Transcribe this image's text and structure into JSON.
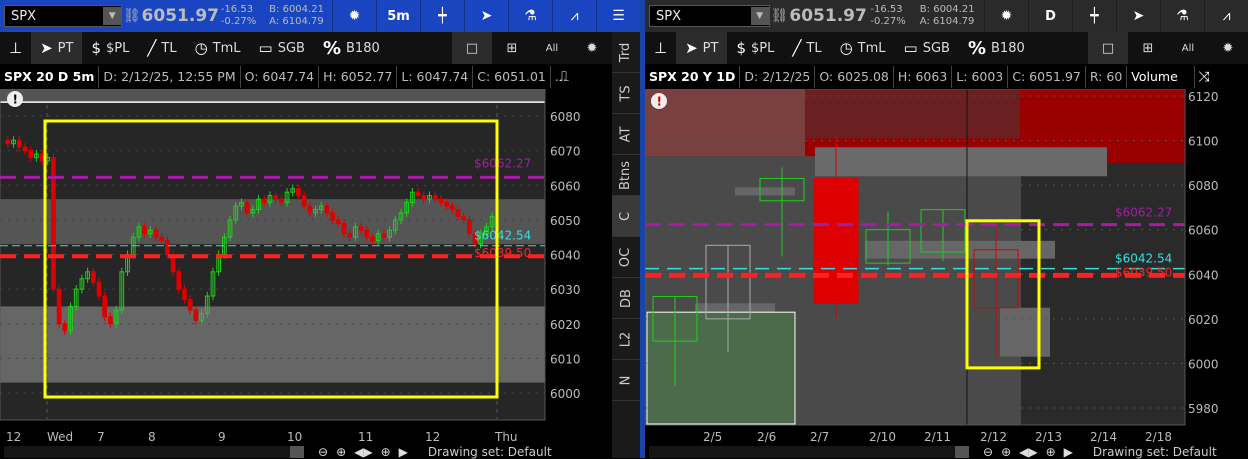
{
  "left": {
    "symbol": "SPX",
    "last": "6051.97",
    "change": "-16.53",
    "change_pct": "-0.27%",
    "bid": "B: 6004.21",
    "ask": "A: 6104.79",
    "timeframe": "5m",
    "tools": [
      {
        "icon": "pin",
        "label": ""
      },
      {
        "icon": "cursor",
        "label": "PT"
      },
      {
        "icon": "$",
        "label": "$PL"
      },
      {
        "icon": "/",
        "label": "TL"
      },
      {
        "icon": "clock",
        "label": "TmL"
      },
      {
        "icon": "□",
        "label": "SGB"
      },
      {
        "icon": "%",
        "label": "B180"
      }
    ],
    "all_label": "All",
    "info": {
      "title": "SPX 20 D 5m",
      "date": "D: 2/12/25, 12:55 PM",
      "open": "O: 6047.74",
      "high": "H: 6052.77",
      "low": "L: 6047.74",
      "close": "C: 6051.01",
      "more": "..."
    },
    "side_tabs": [
      "Trd",
      "TS",
      "AT",
      "Btns",
      "C",
      "OC",
      "DB",
      "L2",
      "N"
    ],
    "active_side_tab": "C",
    "xlabels": [
      "12",
      "Wed",
      "7",
      "8",
      "9",
      "10",
      "11",
      "12",
      "Thu"
    ],
    "drawing_set": "Drawing set: Default"
  },
  "right": {
    "symbol": "SPX",
    "last": "6051.97",
    "change": "-16.53",
    "change_pct": "-0.27%",
    "bid": "B: 6004.21",
    "ask": "A: 6104.79",
    "timeframe": "D",
    "all_label": "All",
    "info": {
      "title": "SPX 20 Y 1D",
      "date": "D: 2/12/25",
      "open": "O: 6025.08",
      "high": "H: 6063",
      "low": "L: 6003",
      "close": "C: 6051.97",
      "range": "R: 60",
      "study": "Volume"
    },
    "xlabels": [
      "2/5",
      "2/6",
      "2/7",
      "2/10",
      "2/11",
      "2/12",
      "2/13",
      "2/14",
      "2/18"
    ],
    "drawing_set": "Drawing set: Default"
  },
  "colors": {
    "accent": "#1946c0",
    "up": "#22cc22",
    "down": "#dd0000",
    "purple": "#a020a0",
    "cyan": "#30e0e0",
    "yellow": "#ffff00"
  },
  "chart_data": [
    {
      "type": "candlestick",
      "title": "SPX 20 D 5m",
      "ylim": [
        5995,
        6085
      ],
      "yticks": [
        6000,
        6010,
        6020,
        6030,
        6040,
        6050,
        6060,
        6070,
        6080
      ],
      "levels": [
        {
          "label": "$6062.27",
          "value": 6062.27,
          "color": "#a020a0"
        },
        {
          "label": "$6042.54",
          "value": 6042.54,
          "color": "#30e0e0"
        },
        {
          "label": "$6039.50",
          "value": 6039.5,
          "color": "#ff2020"
        }
      ],
      "closes": [
        6072,
        6073,
        6071,
        6070,
        6068,
        6069,
        6067,
        6068,
        6030,
        6020,
        6018,
        6025,
        6030,
        6033,
        6035,
        6032,
        6028,
        6022,
        6020,
        6024,
        6035,
        6040,
        6045,
        6048,
        6046,
        6047,
        6045,
        6044,
        6040,
        6035,
        6030,
        6027,
        6024,
        6021,
        6023,
        6028,
        6035,
        6040,
        6045,
        6050,
        6054,
        6055,
        6052,
        6053,
        6056,
        6055,
        6057,
        6056,
        6055,
        6058,
        6059,
        6057,
        6054,
        6052,
        6053,
        6054,
        6052,
        6050,
        6049,
        6046,
        6045,
        6048,
        6047,
        6045,
        6044,
        6046,
        6045,
        6047,
        6050,
        6052,
        6055,
        6058,
        6057,
        6056,
        6057,
        6056,
        6055,
        6054,
        6053,
        6051,
        6050,
        6046,
        6043,
        6046,
        6048,
        6051
      ]
    },
    {
      "type": "candlestick",
      "title": "SPX 20 Y 1D",
      "ylim": [
        5972,
        6122
      ],
      "yticks": [
        5980,
        6000,
        6020,
        6040,
        6060,
        6080,
        6100,
        6120
      ],
      "levels": [
        {
          "label": "$6062.27",
          "value": 6062.27,
          "color": "#a020a0"
        },
        {
          "label": "$6042.54",
          "value": 6042.54,
          "color": "#30e0e0"
        },
        {
          "label": "$6039.50",
          "value": 6039.5,
          "color": "#ff2020"
        }
      ],
      "candles": [
        {
          "date": "2/4",
          "o": 6010,
          "h": 6030,
          "l": 5990,
          "c": 6030,
          "style": "up"
        },
        {
          "date": "2/5",
          "o": 6020,
          "h": 6053,
          "l": 6005,
          "c": 6053,
          "style": "neutral"
        },
        {
          "date": "2/6",
          "o": 6073,
          "h": 6088,
          "l": 6048,
          "c": 6083,
          "style": "up"
        },
        {
          "date": "2/7",
          "o": 6083,
          "h": 6102,
          "l": 6020,
          "c": 6027,
          "style": "downfill"
        },
        {
          "date": "2/10",
          "o": 6045,
          "h": 6068,
          "l": 6044,
          "c": 6060,
          "style": "up"
        },
        {
          "date": "2/11",
          "o": 6050,
          "h": 6069,
          "l": 6046,
          "c": 6069,
          "style": "up"
        },
        {
          "date": "2/12",
          "o": 6051,
          "h": 6063,
          "l": 6003,
          "c": 6025,
          "style": "down"
        }
      ]
    }
  ]
}
